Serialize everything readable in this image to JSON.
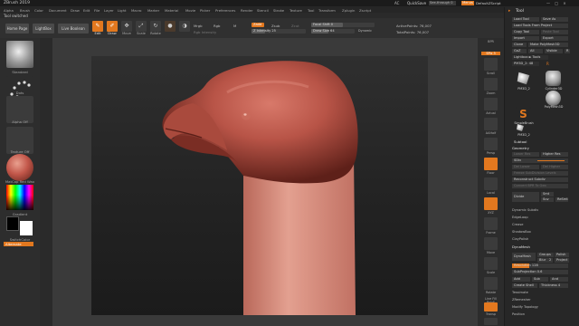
{
  "titlebar": {
    "app_title": "ZBrush 2019",
    "ac": "AC",
    "quicksave": "QuickSave",
    "see_through": "See-through 0",
    "menus": "Menus",
    "default_zscript": "DefaultZScript",
    "window_controls": "— □ ×"
  },
  "menu": [
    "Alpha",
    "Brush",
    "Color",
    "Document",
    "Draw",
    "Edit",
    "File",
    "Layer",
    "Light",
    "Macro",
    "Marker",
    "Material",
    "Movie",
    "Picker",
    "Preferences",
    "Render",
    "Stencil",
    "Stroke",
    "Texture",
    "Tool",
    "Transform",
    "Zplugin",
    "Zscript"
  ],
  "status": {
    "tool_switched": "Tool switched"
  },
  "shelf": {
    "home_page": "Home Page",
    "lightbox": "LightBox",
    "live_boolean": "Live Boolean",
    "edit": "Edit",
    "draw": "Draw",
    "move": "Move",
    "scale": "Scale",
    "rotate": "Rotate",
    "mrgb": "Mrgb",
    "rgb": "Rgb",
    "m": "M",
    "rgb_intensity": "Rgb Intensity",
    "zadd": "Zadd",
    "zsub": "Zsub",
    "zcut": "Zcut",
    "z_intensity": "Z Intensity 25",
    "focal_shift": "Focal Shift 0",
    "draw_size": "Draw Size 64",
    "dynamic": "Dynamic",
    "active_points": "ActivePoints: 76,007",
    "total_points": "TotalPoints: 76,007"
  },
  "left_tray": {
    "brush_label": "Standard",
    "stroke_label": "Dots",
    "alpha_label": "Alpha Off",
    "texture_label": "Texture Off",
    "material_label": "MatCap Red Wax",
    "gradient_label": "Gradient",
    "switch_color_label": "SwitchColor",
    "alternate_label": "Alternate",
    "colors": {
      "main": "#ffffff",
      "secondary": "#000000",
      "material": "#c2574a"
    }
  },
  "right_strip": {
    "labels": [
      "BPR",
      "SPix 3",
      "Scroll",
      "Zoom",
      "Actual",
      "AAHalf",
      "Persp",
      "Floor",
      "Local",
      "XYZ",
      "Frame",
      "Move",
      "Scale",
      "Rotate",
      "Line Fill PolyF",
      "Transp",
      "Ghost",
      "Solo",
      "Xpose"
    ]
  },
  "tool_palette": {
    "header": "Tool",
    "load_tool": "Load Tool",
    "save_as": "Save As",
    "load_from_project": "Load Tools From Project",
    "copy_tool": "Copy Tool",
    "paste_tool": "Paste Tool",
    "import": "Import",
    "export": "Export",
    "clone": "Clone",
    "make_polymesh": "Make PolyMesh3D",
    "goz": "GoZ",
    "all": "All",
    "visible": "Visible",
    "r": "R",
    "lightbox_tools": "Lightbox ► Tools",
    "pm3d_label": "PM3D_2: 48",
    "tools": [
      "PM3D_2",
      "Cylinder3D",
      "PolyMesh3D",
      "SimpleBrush",
      "PM3D_2"
    ],
    "subtool": "Subtool",
    "geometry": "Geometry",
    "lower_res": "Lower Res",
    "higher_res": "Higher Res",
    "sdiv": "SDiv",
    "del_lower": "Del Lower",
    "del_higher": "Del Higher",
    "freeze_subdiv": "Freeze SubDivision Levels",
    "reconstruct_subdiv": "Reconstruct Subdiv",
    "convert_bpr": "Convert BPR To Geo",
    "divide": "Divide",
    "smt": "Smt",
    "suv": "Suv",
    "rsmt": "ReSmt",
    "dynamic_subdiv": "Dynamic Subdiv",
    "edgeloop": "EdgeLoop",
    "crease": "Crease",
    "shadowbox": "ShadowBox",
    "claypolish": "ClayPolish",
    "dynamesh_section": "DynaMesh",
    "dynamesh": "DynaMesh",
    "groups": "Groups",
    "polish": "Polish",
    "blur": "Blur",
    "blur_val": "2",
    "project": "Project",
    "resolution": "Resolution 128",
    "subprojection": "SubProjection 0.6",
    "add": "Add",
    "sub": "Sub",
    "and": "And",
    "create_shell": "Create Shell",
    "thickness": "Thickness 4",
    "tessimate": "Tessimate",
    "zremesher": "ZRemesher",
    "modify_topology": "Modify Topology",
    "position": "Position"
  },
  "colors": {
    "accent": "#e2781f",
    "model": "#b85447",
    "background": "#2a2a2a"
  }
}
